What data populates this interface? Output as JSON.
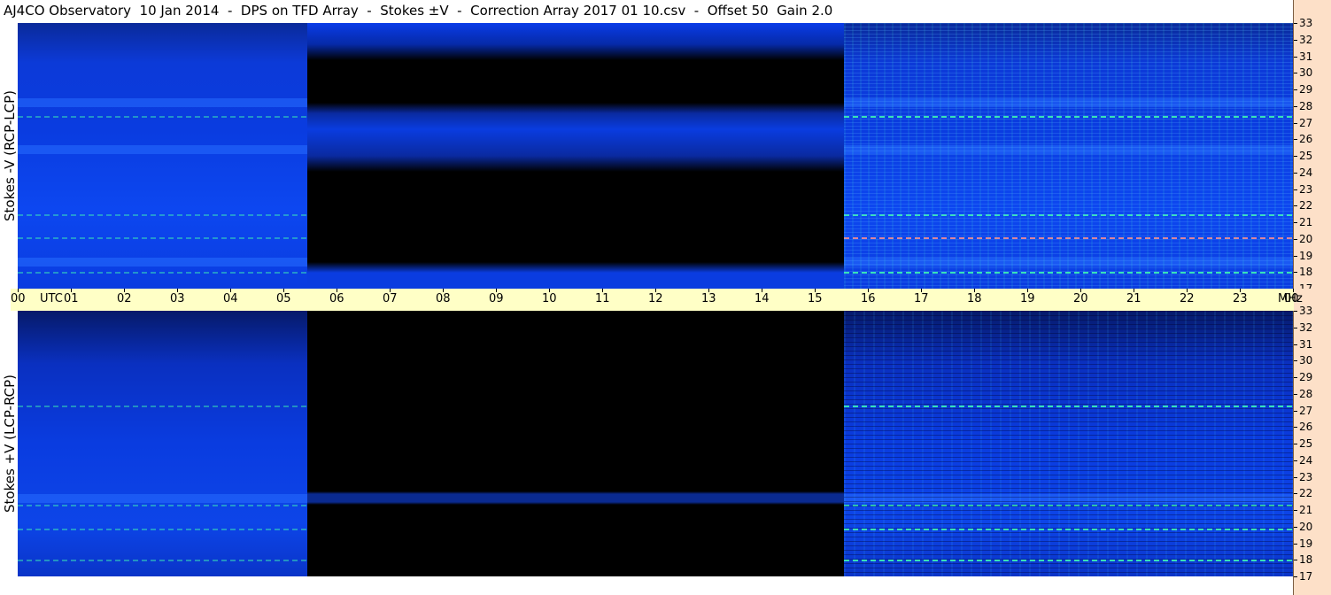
{
  "chart_data": {
    "type": "heatmap",
    "title": "AJ4CO Observatory  10 Jan 2014  -  DPS on TFD Array  -  Stokes ±V  -  Correction Array 2017 01 10.csv  -  Offset 50  Gain 2.0",
    "x": {
      "unit": "UTC",
      "range_hours": [
        0,
        24
      ],
      "tick_labels": [
        "00",
        "01",
        "02",
        "03",
        "04",
        "05",
        "06",
        "07",
        "08",
        "09",
        "10",
        "11",
        "12",
        "13",
        "14",
        "15",
        "16",
        "17",
        "18",
        "19",
        "20",
        "21",
        "22",
        "23",
        "00"
      ],
      "first_label_extra": "UTC"
    },
    "y": {
      "unit": "MHz",
      "range_mhz": [
        17,
        33
      ],
      "tick_labels": [
        "33",
        "32",
        "31",
        "30",
        "29",
        "28",
        "27",
        "26",
        "25",
        "24",
        "23",
        "22",
        "21",
        "20",
        "19",
        "18",
        "17"
      ]
    },
    "panels": [
      {
        "name": "Stokes -V (RCP-LCP)",
        "no_data_start_utc": 5.45,
        "no_data_end_utc": 15.55,
        "interference_bands_mhz": [
          27.4,
          21.5,
          20.1,
          18.0
        ],
        "bright_bands_mhz": [
          28.2,
          25.4,
          18.6
        ]
      },
      {
        "name": "Stokes +V (LCP-RCP)",
        "no_data_start_utc": 5.45,
        "no_data_end_utc": 15.55,
        "interference_bands_mhz": [
          27.3,
          21.3,
          19.9,
          18.0
        ],
        "bright_bands_mhz": [
          21.7
        ]
      }
    ],
    "colormap": {
      "low": "#000000",
      "mid": "#0a3ce0",
      "high": "#40ffb0",
      "peak": "#ff9090"
    },
    "grid": false
  }
}
